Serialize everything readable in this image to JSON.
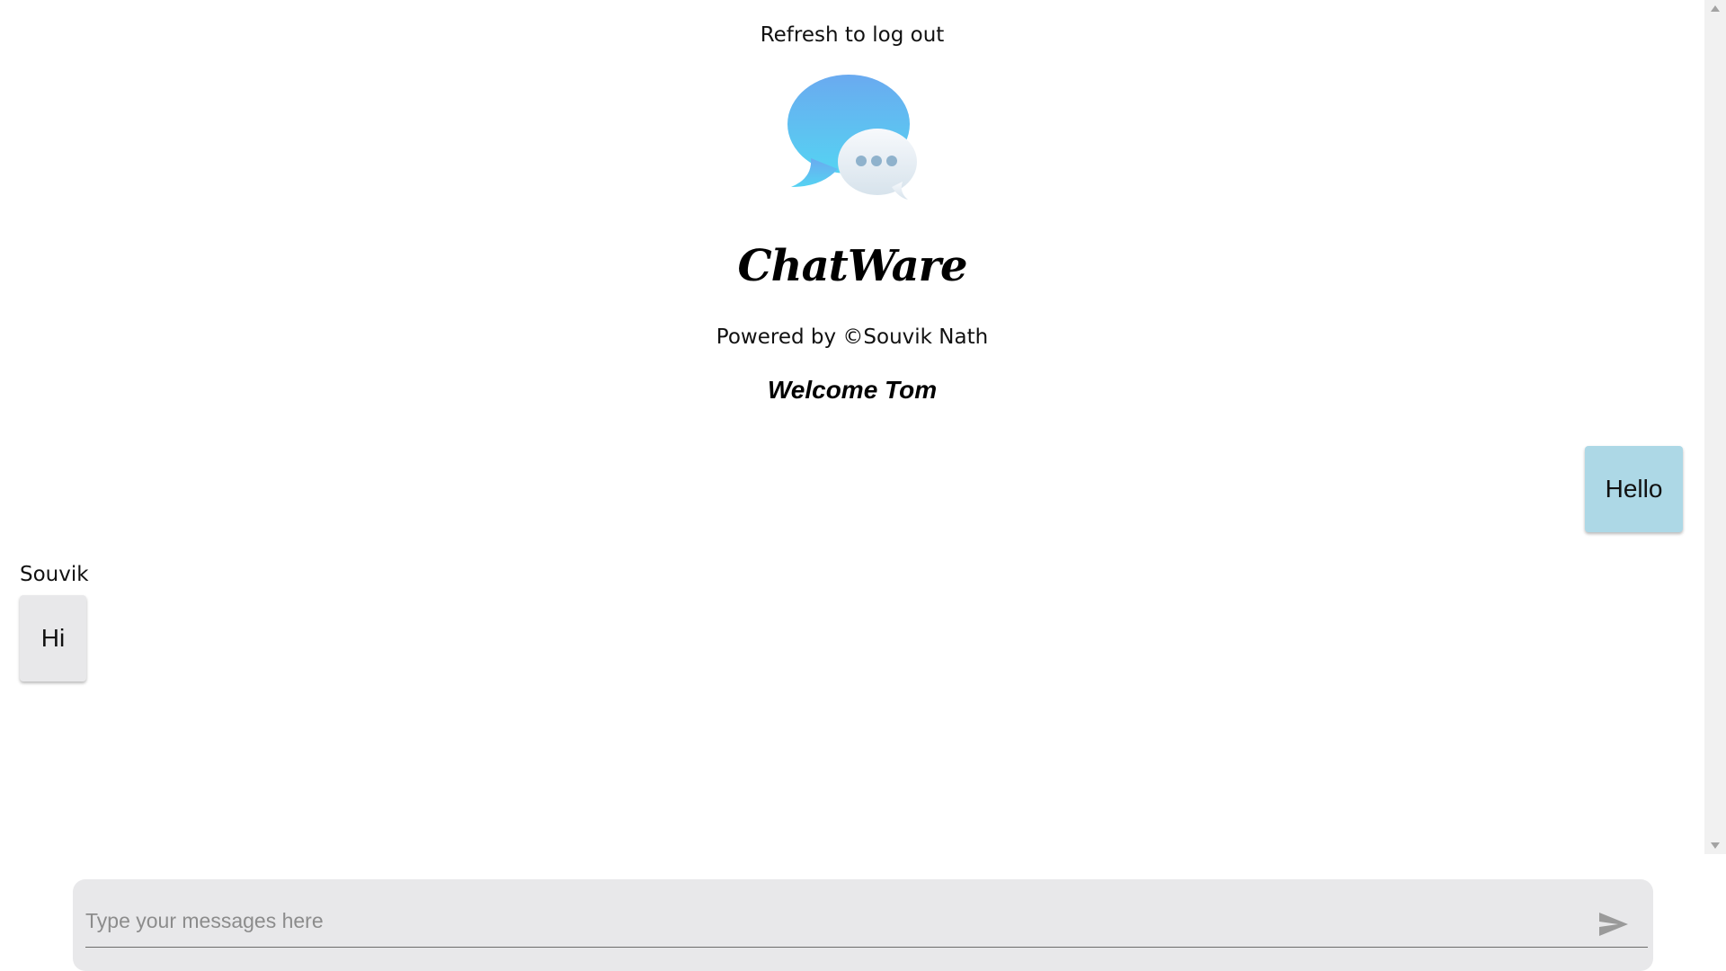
{
  "header": {
    "logout_text": "Refresh to log out",
    "app_name": "ChatWare",
    "powered_by": "Powered by ©Souvik Nath",
    "welcome": "Welcome Tom",
    "logo_icon": "chat-bubbles-icon"
  },
  "messages": [
    {
      "direction": "sent",
      "sender": "",
      "text": "Hello"
    },
    {
      "direction": "received",
      "sender": "Souvik",
      "text": "Hi"
    }
  ],
  "composer": {
    "placeholder": "Type your messages here",
    "value": "",
    "send_icon": "send-icon"
  },
  "colors": {
    "sent_bubble": "#add8e6",
    "received_bubble": "#e8e8ea",
    "composer_bg": "#e8e8ea"
  }
}
